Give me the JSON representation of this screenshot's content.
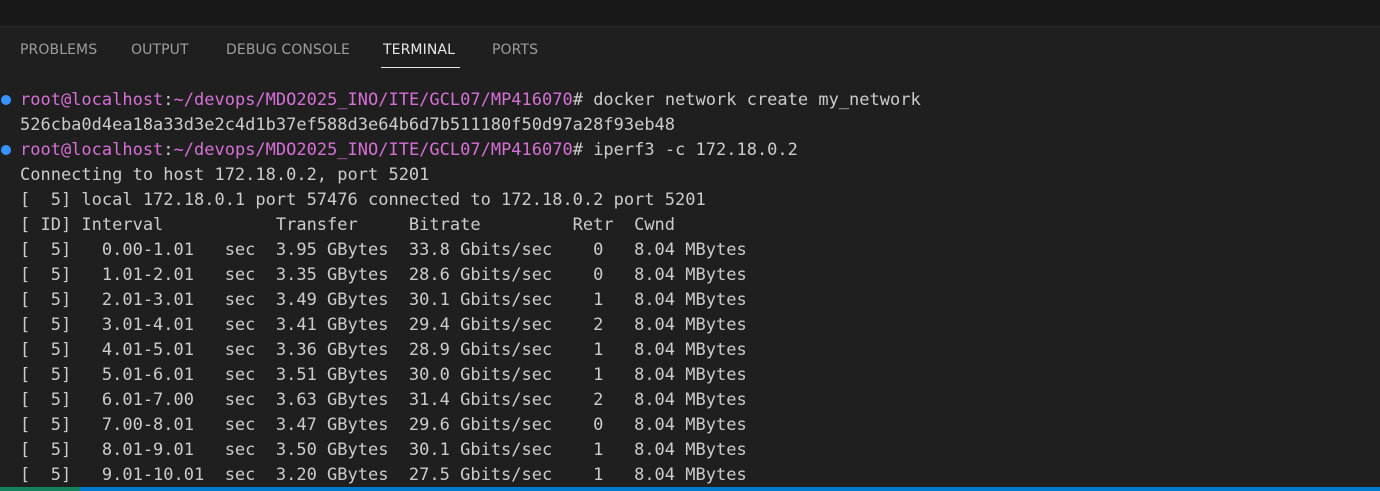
{
  "panel": {
    "tabs": [
      {
        "label": "PROBLEMS"
      },
      {
        "label": "OUTPUT"
      },
      {
        "label": "DEBUG CONSOLE"
      },
      {
        "label": "TERMINAL"
      },
      {
        "label": "PORTS"
      }
    ],
    "active_tab": "TERMINAL"
  },
  "terminal": {
    "prompt_user": "root@localhost",
    "prompt_path": "~/devops/MDO2025_INO/ITE/GCL07/MP416070",
    "commands": [
      "# docker network create my_network",
      "# iperf3 -c 172.18.0.2"
    ],
    "lines": [
      "526cba0d4ea18a33d3e2c4d1b37ef588d3e64b6d7b511180f50d97a28f93eb48",
      "Connecting to host 172.18.0.2, port 5201",
      "[  5] local 172.18.0.1 port 57476 connected to 172.18.0.2 port 5201",
      "[ ID] Interval           Transfer     Bitrate         Retr  Cwnd",
      "[  5]   0.00-1.01   sec  3.95 GBytes  33.8 Gbits/sec    0   8.04 MBytes",
      "[  5]   1.01-2.01   sec  3.35 GBytes  28.6 Gbits/sec    0   8.04 MBytes",
      "[  5]   2.01-3.01   sec  3.49 GBytes  30.1 Gbits/sec    1   8.04 MBytes",
      "[  5]   3.01-4.01   sec  3.41 GBytes  29.4 Gbits/sec    2   8.04 MBytes",
      "[  5]   4.01-5.01   sec  3.36 GBytes  28.9 Gbits/sec    1   8.04 MBytes",
      "[  5]   5.01-6.01   sec  3.51 GBytes  30.0 Gbits/sec    1   8.04 MBytes",
      "[  5]   6.01-7.00   sec  3.63 GBytes  31.4 Gbits/sec    2   8.04 MBytes",
      "[  5]   7.00-8.01   sec  3.47 GBytes  29.6 Gbits/sec    0   8.04 MBytes",
      "[  5]   8.01-9.01   sec  3.50 GBytes  30.1 Gbits/sec    1   8.04 MBytes",
      "[  5]   9.01-10.01  sec  3.20 GBytes  27.5 Gbits/sec    1   8.04 MBytes"
    ]
  },
  "colors": {
    "background": "#1f1f1f",
    "prompt": "#d670d6",
    "text": "#cccccc",
    "decoration": "#3794ff",
    "status_bar": "#007acc"
  }
}
